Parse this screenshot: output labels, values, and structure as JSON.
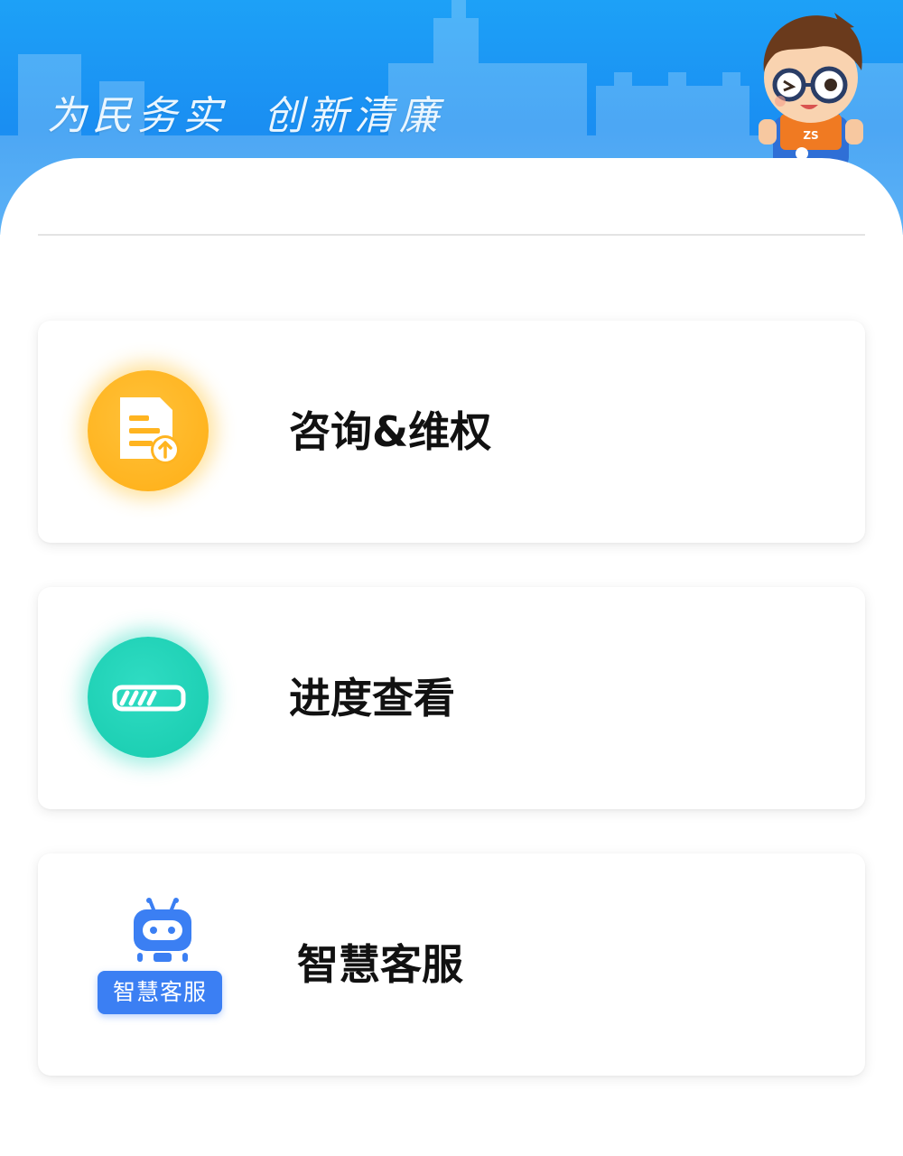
{
  "banner": {
    "slogan": "为民务实  创新清廉",
    "mascot_badge": "ZS"
  },
  "menu": {
    "items": [
      {
        "label": "咨询&维权",
        "icon": "document-upload-icon",
        "color": "#ffb420"
      },
      {
        "label": "进度查看",
        "icon": "progress-bar-icon",
        "color": "#1ed0b4"
      },
      {
        "label": "智慧客服",
        "icon": "robot-icon",
        "badge": "智慧客服",
        "color": "#3b7ff3"
      }
    ]
  }
}
